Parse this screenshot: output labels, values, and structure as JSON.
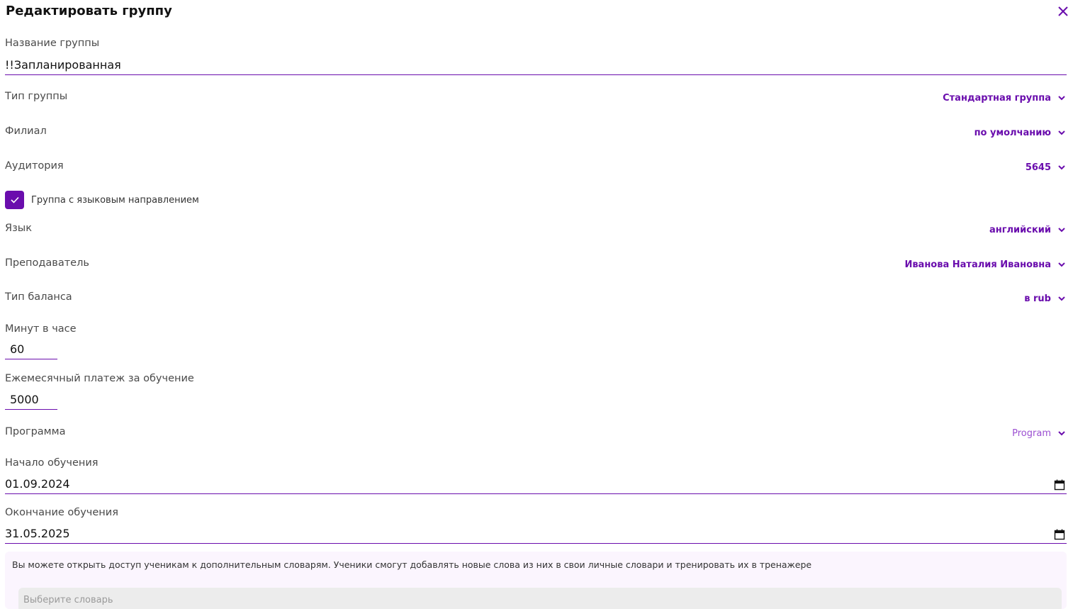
{
  "dialog": {
    "title": "Редактировать группу"
  },
  "group_name": {
    "label": "Название группы",
    "value": "!!Запланированная"
  },
  "group_type": {
    "label": "Тип группы",
    "value": "Стандартная группа"
  },
  "branch": {
    "label": "Филиал",
    "value": "по умолчанию"
  },
  "room": {
    "label": "Аудитория",
    "value": "5645"
  },
  "language_group": {
    "label": "Группа с языковым направлением",
    "checked": true
  },
  "language": {
    "label": "Язык",
    "value": "английский"
  },
  "teacher": {
    "label": "Преподаватель",
    "value": "Иванова Наталия Ивановна"
  },
  "balance_type": {
    "label": "Тип баланса",
    "value": "в rub"
  },
  "minutes_per_hour": {
    "label": "Минут в часе",
    "value": "60"
  },
  "monthly_payment": {
    "label": "Ежемесячный платеж за обучение",
    "value": "5000"
  },
  "program": {
    "label": "Программа",
    "value": "Program"
  },
  "start_date": {
    "label": "Начало обучения",
    "value": "01.09.2024"
  },
  "end_date": {
    "label": "Окончание обучения",
    "value": "31.05.2025"
  },
  "dictionaries": {
    "info": "Вы можете открыть доступ ученикам к дополнительным словарям. Ученики смогут добавлять новые слова из них в свои личные словари и тренировать их в тренажере",
    "placeholder": "Выберите словарь"
  },
  "colors": {
    "accent": "#6a0dad",
    "accent_light": "#9b4fd1",
    "info_bg": "#fbf5fe",
    "select_bg": "#ececec"
  }
}
